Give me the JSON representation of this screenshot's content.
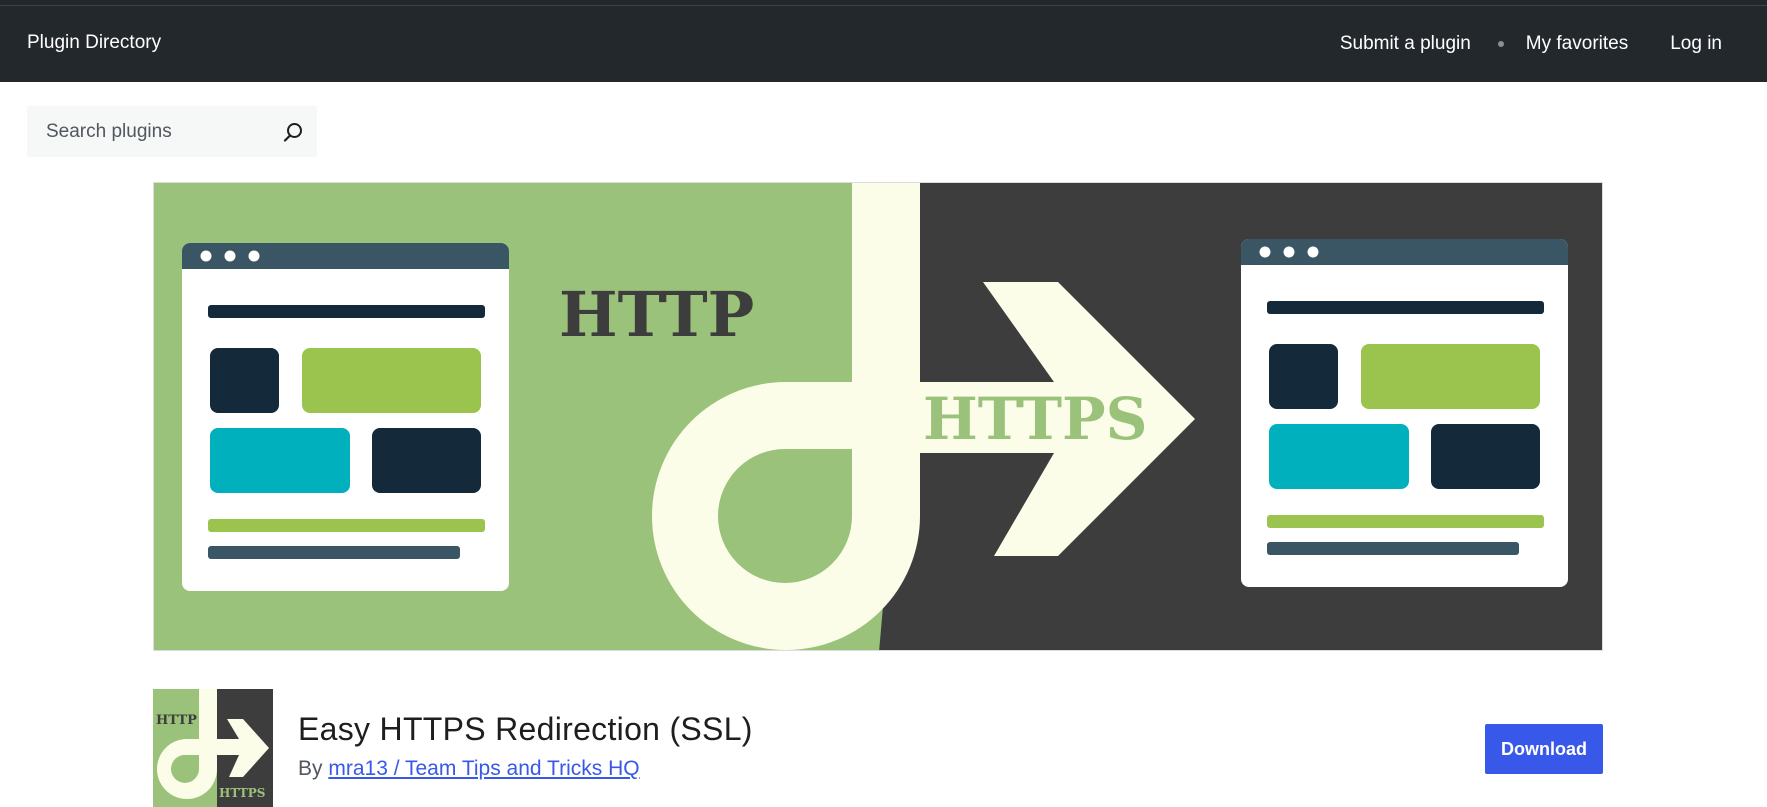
{
  "nav": {
    "brand": "Plugin Directory",
    "links": [
      "Submit a plugin",
      "My favorites",
      "Log in"
    ]
  },
  "search": {
    "placeholder": "Search plugins",
    "value": ""
  },
  "banner": {
    "left_text": "HTTP",
    "right_text": "HTTPS"
  },
  "plugin": {
    "title": "Easy HTTPS Redirection (SSL)",
    "by_prefix": "By",
    "author": "mra13 / Team Tips and Tricks HQ",
    "download_label": "Download",
    "icon_top_text": "HTTP",
    "icon_bottom_text": "HTTPS"
  },
  "colors": {
    "nav_bg": "#23282d",
    "accent": "#3858e9",
    "banner_green": "#9bc27a",
    "banner_dark": "#3d3d3d",
    "cream": "#fbfde8"
  }
}
